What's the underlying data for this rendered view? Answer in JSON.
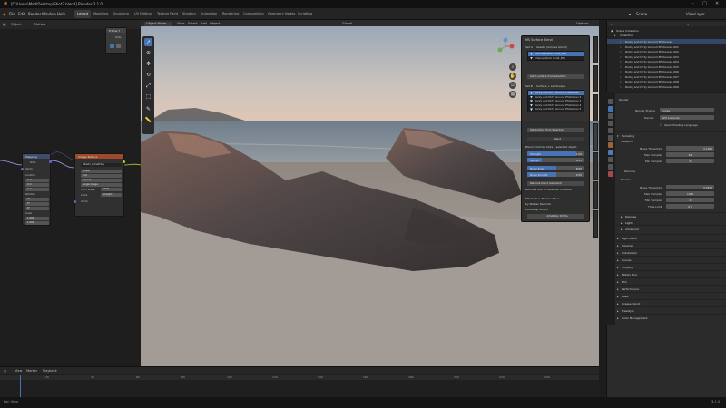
{
  "window": {
    "title": "Blender 3.1.0",
    "path": "[C:\\Users\\Mad\\Desktop\\Shot2.blend]"
  },
  "menubar": {
    "menus": [
      "File",
      "Edit",
      "Render",
      "Window",
      "Help"
    ],
    "workspaces": [
      "Layout",
      "Modeling",
      "Sculpting",
      "UV Editing",
      "Texture Paint",
      "Shading",
      "Animation",
      "Rendering",
      "Compositing",
      "Geometry Nodes",
      "Scripting"
    ],
    "active_workspace": "Layout",
    "scene_label": "Scene",
    "view_layer_label": "ViewLayer"
  },
  "node_editor": {
    "header": [
      "Object",
      "View",
      "Select",
      "Add",
      "Node"
    ],
    "object_label": "Mattes",
    "group_label": "Material",
    "slot_label": "Slot",
    "node1": {
      "title": "Mapping",
      "type_label": "Point",
      "rows": [
        "Vector",
        "Location",
        "Rotation",
        "Scale"
      ],
      "vals": [
        "0 m",
        "0 m",
        "0 m",
        "0°",
        "0°",
        "0°",
        "1.000",
        "1.000",
        "1.000"
      ]
    },
    "node2": {
      "title": "Image Texture",
      "file": "albedo_something",
      "rows": [
        "Linear",
        "Flat",
        "Repeat",
        "Single Image",
        "Color Space",
        "Alpha",
        "Vector"
      ],
      "vals": [
        "sRGB",
        "Straight"
      ]
    },
    "frame": {
      "title": "Frame 7",
      "label": "Slots"
    }
  },
  "viewport": {
    "header": [
      "Object Mode",
      "View",
      "Select",
      "Add",
      "Object"
    ],
    "transform": "Global",
    "options_label": "Options"
  },
  "ms_panel": {
    "title": "MS Surface Blend",
    "section_a": "Set A",
    "section_a_label": "Assets (remove blend)",
    "list_a": [
      "Concrete Rock (rnd4_8G)",
      "Channel Rock (rnd2_8G)"
    ],
    "set_a_button": "Set A surface from selection",
    "section_b": "Set B",
    "section_b_label": "Surface + Landscape",
    "list_b": [
      "Rocky and Dirty Ground Photoscan",
      "Rocky and Dirty Ground Photoscan 2",
      "Rocky and Dirty Ground Photoscan 3",
      "Rocky and Dirty Ground Photoscan 4",
      "Rocky and Dirty Ground Photoscan 5"
    ],
    "set_b_button": "Set Surface from Selection",
    "blend_header": "Blend",
    "blend_label": "Blend Controls Slots – selected object",
    "sliders": [
      {
        "key": "Strength",
        "val": "1.00",
        "fill": 0.85
      },
      {
        "key": "Spread",
        "val": "0.25",
        "fill": 0.25
      },
      {
        "key": "Noise Scale",
        "val": "8.00",
        "fill": 0.5
      },
      {
        "key": "Noise Smooth",
        "val": "0.50",
        "fill": 0.5
      }
    ],
    "remove_label": "Remove blend (selected)",
    "remove2_label": "Remove edit on selected material",
    "version": "MS Surface Blend v1.5.4",
    "author": "by Mattes Heinrich",
    "support": "Doubleup Studio",
    "website_button": "Artstation Profile"
  },
  "outliner": {
    "title": "Scene Collection",
    "rows": [
      "Collection",
      "Rocky and Dirty Ground Photoscan",
      "Rocky and Dirty Ground Photoscan.001",
      "Rocky and Dirty Ground Photoscan.002",
      "Rocky and Dirty Ground Photoscan.003",
      "Rocky and Dirty Ground Photoscan.004",
      "Rocky and Dirty Ground Photoscan.005",
      "Rocky and Dirty Ground Photoscan.006",
      "Rocky and Dirty Ground Photoscan.007",
      "Rocky and Dirty Ground Photoscan.008",
      "Rocky and Dirty Ground Photoscan.009",
      "Rocky and Dirty Ground Photoscan.010",
      "Rocky and Dirty Ground Photoscan.011"
    ]
  },
  "properties": {
    "tab_label": "Render",
    "render_engine_label": "Render Engine",
    "render_engine": "Cycles",
    "device_label": "Device",
    "device": "GPU Compute",
    "osl_label": "Open Shading Language",
    "sampling": "Sampling",
    "viewport": "Viewport",
    "noise_threshold_label": "Noise Threshold",
    "noise_threshold": "0.1000",
    "max_samples_label": "Max Samples",
    "max_samples": "64",
    "min_samples_label": "Min Samples",
    "min_samples": "0",
    "denoise": "Denoise",
    "render": "Render",
    "r_noise_threshold": "0.0100",
    "r_max_samples": "1024",
    "r_min_samples": "0",
    "time_limit_label": "Time Limit",
    "time_limit": "0 s",
    "sections": [
      "Denoise",
      "Lights",
      "Advanced",
      "Light Paths",
      "Volumes",
      "Subdivision",
      "Curves",
      "Simplify",
      "Motion Blur",
      "Film",
      "Performance",
      "Bake",
      "Grease Pencil",
      "Freestyle",
      "Color Management"
    ]
  },
  "timeline": {
    "menus": [
      "View",
      "Marker",
      "Playback"
    ],
    "frame_ticks": [
      "20",
      "40",
      "60",
      "80",
      "100",
      "120",
      "140",
      "160",
      "180",
      "200",
      "220",
      "240"
    ]
  },
  "statusbar": {
    "left": "Pan View",
    "right": "3.1.0"
  },
  "colors": {
    "accent": "#4772b3",
    "orange_node": "#9c4a2a",
    "blue_node": "#3d4d6b"
  }
}
